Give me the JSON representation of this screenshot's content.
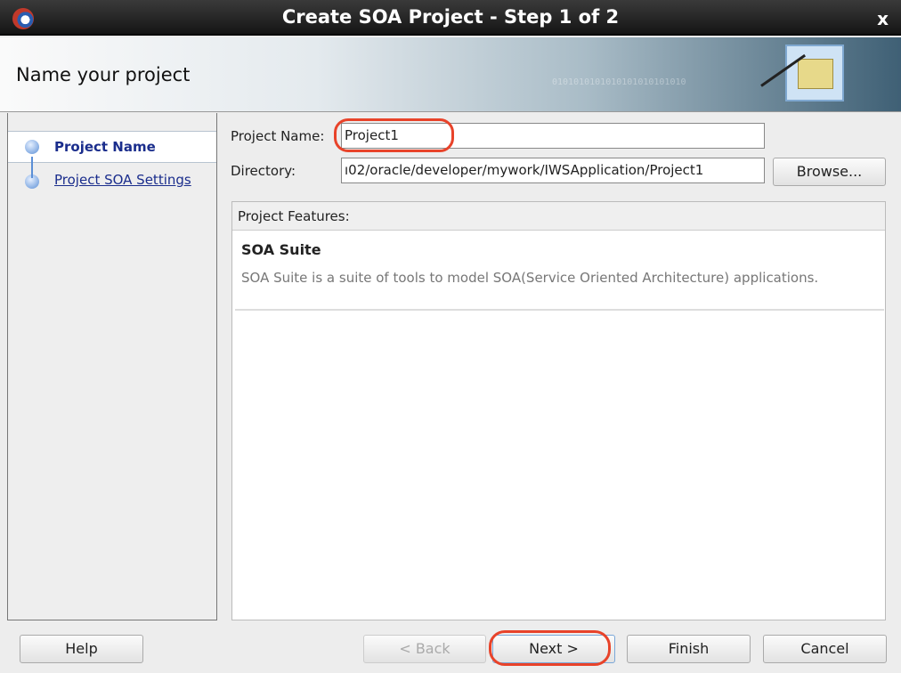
{
  "window": {
    "title": "Create SOA Project - Step 1 of 2",
    "close": "x"
  },
  "header": {
    "title": "Name your project",
    "binary": "0101010101010101010101010"
  },
  "steps": [
    {
      "label": "Project Name",
      "active": true
    },
    {
      "label": "Project SOA Settings",
      "active": false
    }
  ],
  "form": {
    "project_name_label": "Project Name:",
    "project_name_value": "Project1",
    "directory_label": "Directory:",
    "directory_value": "ı02/oracle/developer/mywork/IWSApplication/Project1",
    "browse_label": "Browse..."
  },
  "features": {
    "header": "Project Features:",
    "items": [
      {
        "title": "SOA Suite",
        "description": "SOA Suite is a suite of tools to model SOA(Service Oriented Architecture) applications."
      }
    ]
  },
  "buttons": {
    "help": "Help",
    "back": "< Back",
    "next": "Next >",
    "finish": "Finish",
    "cancel": "Cancel"
  },
  "highlight_color": "#e8432a"
}
